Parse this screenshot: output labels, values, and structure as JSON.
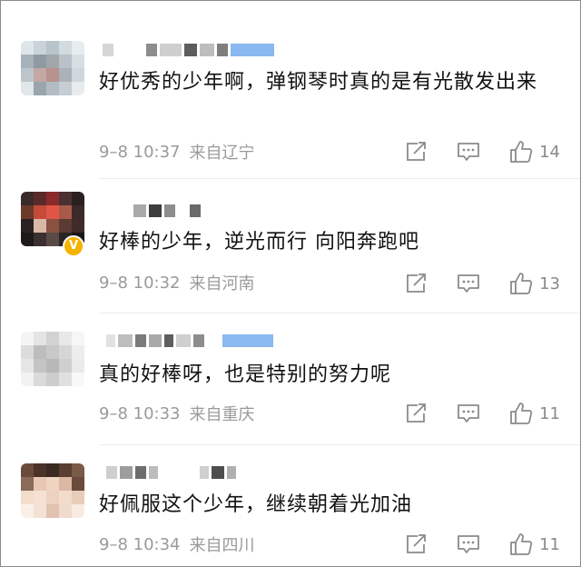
{
  "comments": [
    {
      "text": "好优秀的少年啊，弹钢琴时真的是有光散发出来",
      "time": "9–8 10:37",
      "location": "来自辽宁",
      "likes": "14",
      "verified": false
    },
    {
      "text": "好棒的少年，逆光而行 向阳奔跑吧",
      "time": "9–8 10:32",
      "location": "来自河南",
      "likes": "13",
      "verified": true
    },
    {
      "text": "真的好棒呀，也是特别的努力呢",
      "time": "9–8 10:33",
      "location": "来自重庆",
      "likes": "11",
      "verified": false
    },
    {
      "text": "好佩服这个少年，继续朝着光加油",
      "time": "9–8 10:34",
      "location": "来自四川",
      "likes": "11",
      "verified": false
    }
  ],
  "icons": {
    "share": "share-icon",
    "reply": "comment-icon",
    "like": "thumbs-up-icon",
    "verified": "verified-badge-icon"
  },
  "colors": {
    "text": "#111111",
    "meta": "#9a9a9a",
    "verified_badge": "#f5b400",
    "mosaic_blue": "#8ab8f0"
  }
}
